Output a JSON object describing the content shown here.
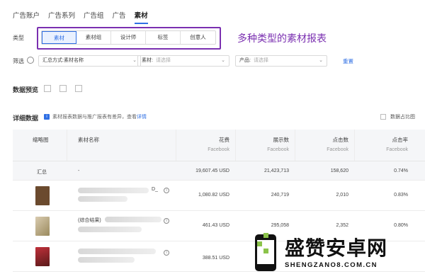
{
  "tabs": [
    {
      "label": "广告账户",
      "active": false
    },
    {
      "label": "广告系列",
      "active": false
    },
    {
      "label": "广告组",
      "active": false
    },
    {
      "label": "广告",
      "active": false
    },
    {
      "label": "素材",
      "active": true
    }
  ],
  "type_filter": {
    "label": "类型",
    "options": [
      "素材",
      "素材组",
      "设计师",
      "标签",
      "创意人"
    ],
    "selected": "素材"
  },
  "annotation": "多种类型的素材报表",
  "filters": {
    "label": "筛选",
    "group_by": {
      "prefix": "汇总方式:",
      "value": "素材名称"
    },
    "material": {
      "prefix": "素材:",
      "placeholder": "请选择"
    },
    "product": {
      "prefix": "产品:",
      "placeholder": "请选择"
    },
    "reset_label": "重置"
  },
  "data_preview_title": "数据预览",
  "detail_title": "详细数据",
  "notice": {
    "text": "素材报表数据与推广报表有差异，查看",
    "link": "详情"
  },
  "ratio_toggle_label": "数据占比图",
  "table": {
    "columns": [
      {
        "label": "缩略图",
        "sub": ""
      },
      {
        "label": "素材名称",
        "sub": ""
      },
      {
        "label": "花费",
        "sub": "Facebook"
      },
      {
        "label": "展示数",
        "sub": "Facebook"
      },
      {
        "label": "点击数",
        "sub": "Facebook"
      },
      {
        "label": "点击率",
        "sub": "Facebook"
      }
    ],
    "summary": {
      "label": "汇总",
      "name": "-",
      "spend": "19,607.45 USD",
      "impressions": "21,423,713",
      "clicks": "158,620",
      "ctr": "0.74%"
    },
    "rows": [
      {
        "name_fragment": "D_",
        "spend": "1,080.82 USD",
        "impressions": "240,719",
        "clicks": "2,010",
        "ctr": "0.83%",
        "thumb_color": "#6b4a2e"
      },
      {
        "name_fragment": "(综合结果)",
        "spend": "461.43 USD",
        "impressions": "295,058",
        "clicks": "2,352",
        "ctr": "0.80%",
        "thumb_color": "#b7a07a"
      },
      {
        "name_fragment": "",
        "spend": "388.51 USD",
        "impressions": "",
        "clicks": "",
        "ctr": "",
        "thumb_color": "#c0303a"
      }
    ]
  },
  "watermark": {
    "title": "盛赞安卓网",
    "url": "SHENGZANO8.COM.CN"
  }
}
